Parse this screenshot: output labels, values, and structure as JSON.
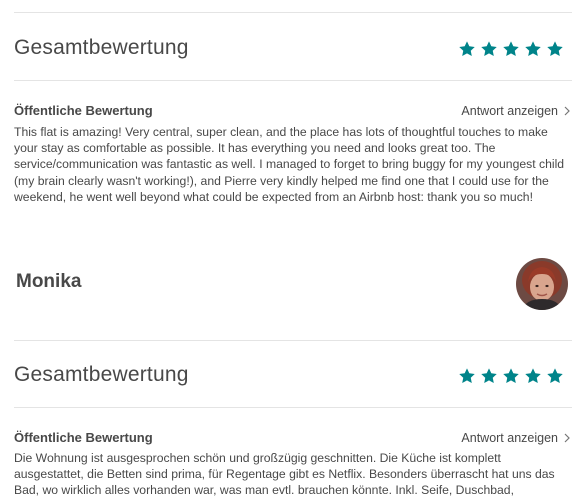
{
  "reviews": [
    {
      "overall_title": "Gesamtbewertung",
      "rating": 5,
      "public_label": "Öffentliche Bewertung",
      "response_link": "Antwort anzeigen",
      "text": "This flat is amazing! Very central, super clean, and the place has lots of thoughtful touches to make your stay as comfortable as possible. It has everything you need and looks great too. The service/communication was fantastic as well. I managed to forget to bring buggy for my youngest child (my brain clearly wasn't working!), and Pierre very kindly helped me find one that I could use for the weekend, he went well beyond what could be expected from an Airbnb host: thank you so much!"
    },
    {
      "reviewer": "Monika",
      "overall_title": "Gesamtbewertung",
      "rating": 5,
      "public_label": "Öffentliche Bewertung",
      "response_link": "Antwort anzeigen",
      "text": "Die Wohnung ist ausgesprochen schön und großzügig geschnitten. Die Küche ist komplett ausgestattet, die Betten sind prima, für Regentage gibt es Netflix. Besonders überrascht hat uns das Bad, wo wirklich alles vorhanden war, was man evtl. brauchen könnte. Inkl. Seife, Duschbad,"
    }
  ],
  "colors": {
    "star": "#00848a",
    "text": "#484848",
    "divider": "#e4e4e4"
  },
  "icons": {
    "star": "star-icon",
    "chevron": "chevron-right-icon",
    "avatar": "avatar"
  }
}
